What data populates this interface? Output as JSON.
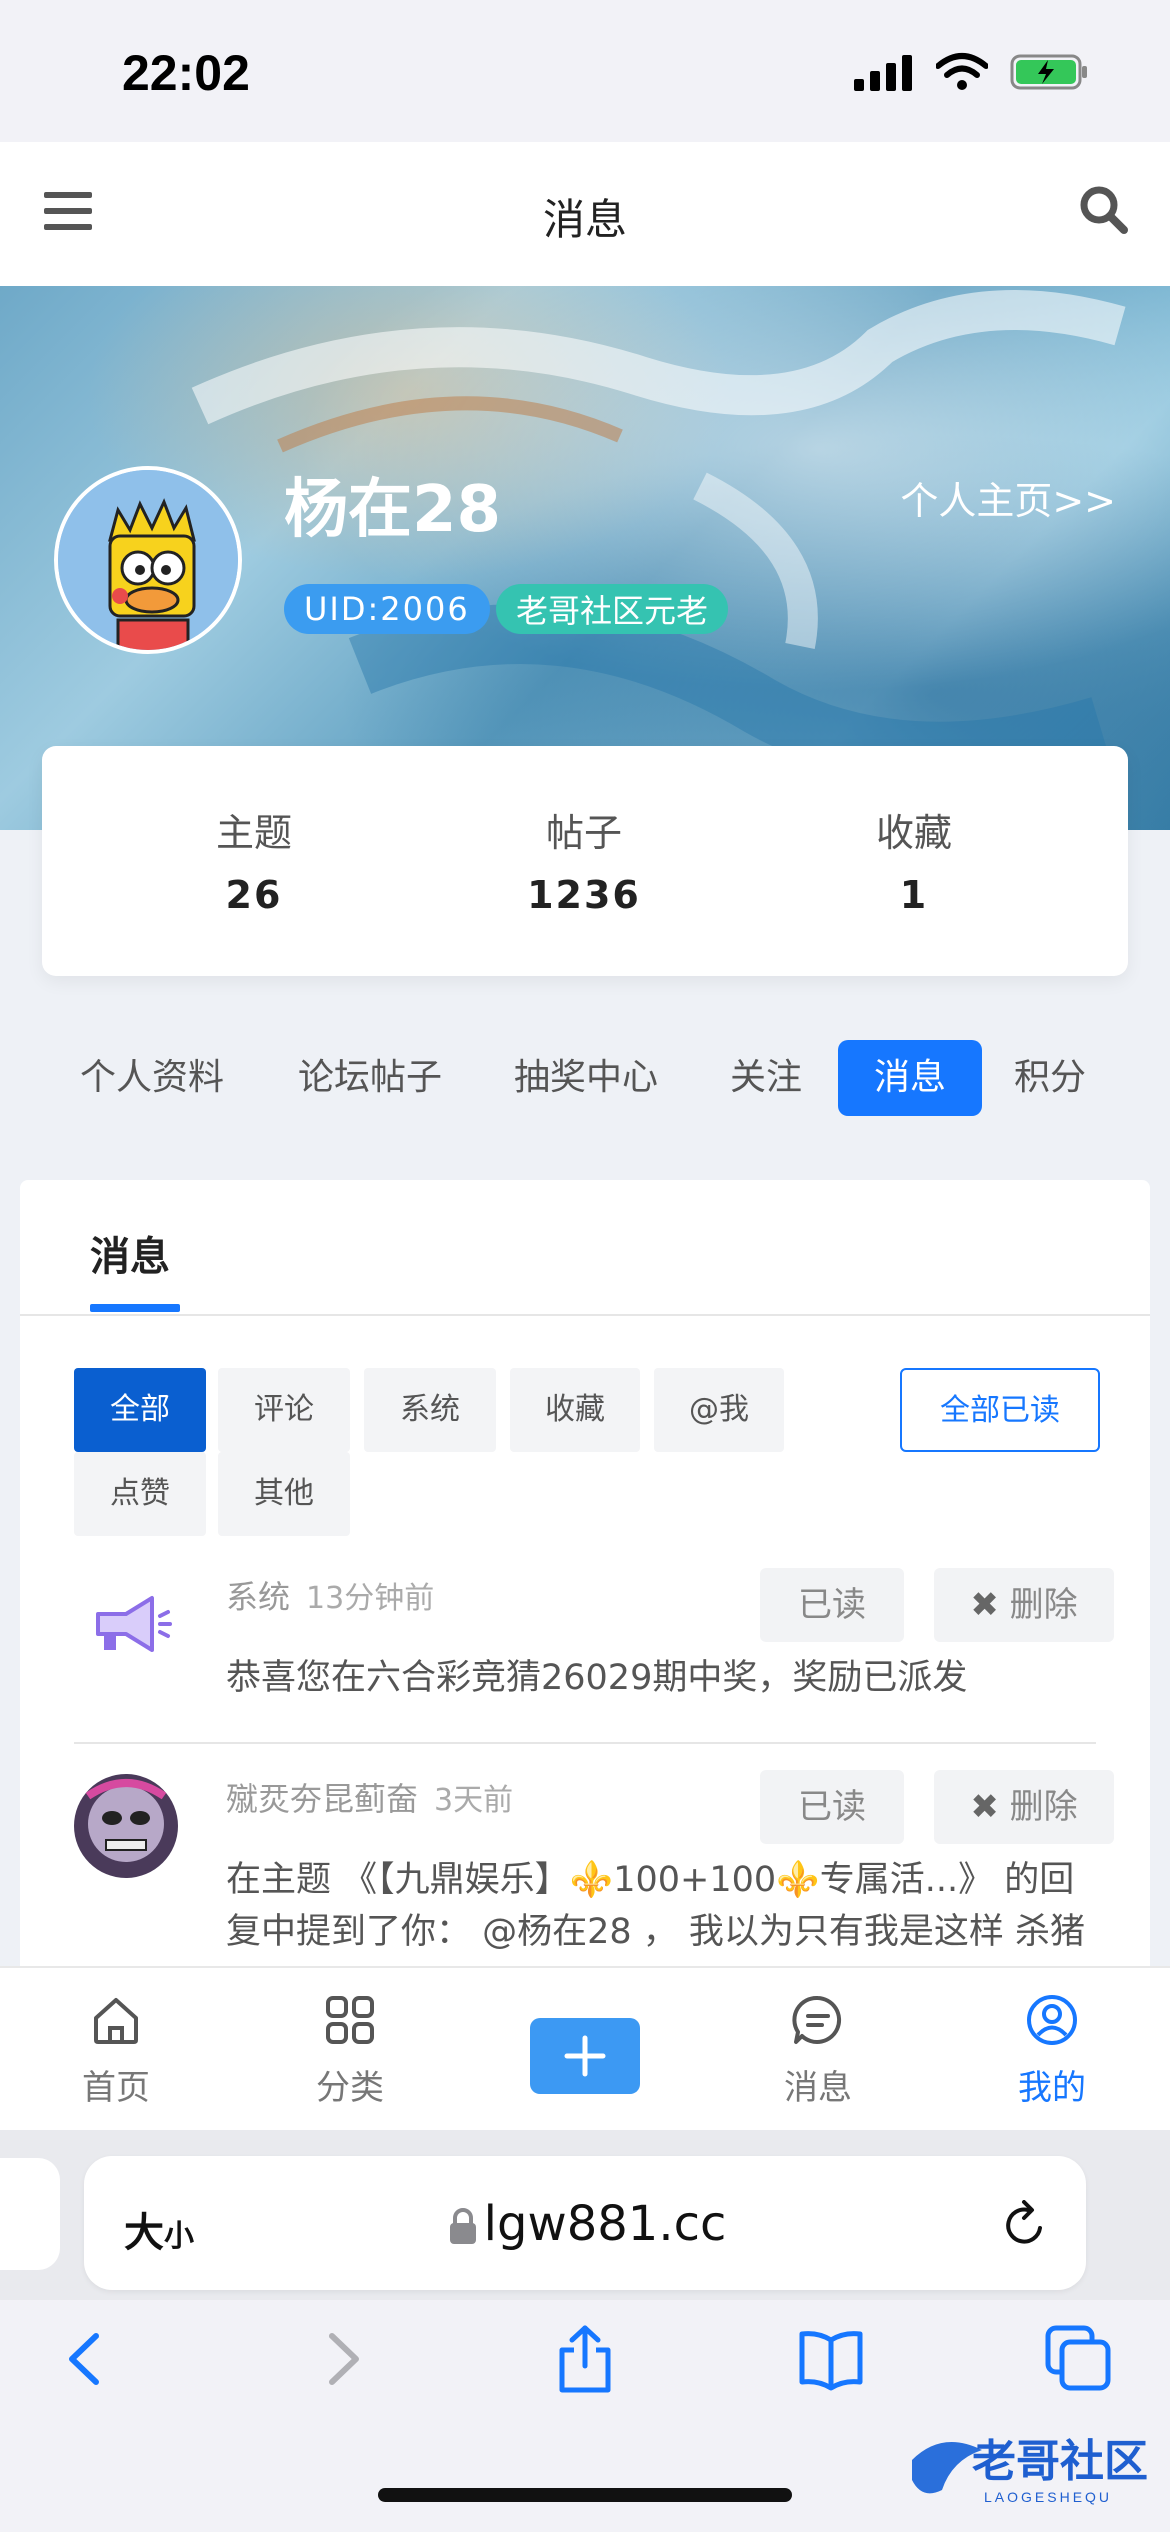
{
  "status": {
    "time": "22:02"
  },
  "header": {
    "title": "消息"
  },
  "profile": {
    "username": "杨在28",
    "home_link": "个人主页>>",
    "uid_badge": "UID:2006",
    "level_badge": "老哥社区元老"
  },
  "stats": [
    {
      "label": "主题",
      "value": "26"
    },
    {
      "label": "帖子",
      "value": "1236"
    },
    {
      "label": "收藏",
      "value": "1"
    }
  ],
  "nav_tabs": [
    "个人资料",
    "论坛帖子",
    "抽奖中心",
    "关注",
    "消息",
    "积分"
  ],
  "nav_active": "消息",
  "panel": {
    "title": "消息",
    "filters": [
      "全部",
      "评论",
      "系统",
      "收藏",
      "@我",
      "点赞",
      "其他"
    ],
    "active_filter": "全部",
    "mark_all_read": "全部已读"
  },
  "messages": [
    {
      "author": "系统",
      "time": "13分钟前",
      "read_label": "已读",
      "delete_label": "删除",
      "text": "恭喜您在六合彩竞猜26029期中奖，奖励已派发"
    },
    {
      "author": "殧烎夯昆蓟奤",
      "time": "3天前",
      "read_label": "已读",
      "delete_label": "删除",
      "text": "在主题 《【九鼎娱乐】⚜️100+100⚜️专属活...》 的回复中提到了你： @杨在28 ， 我以为只有我是这样 杀猪"
    }
  ],
  "tabbar": [
    {
      "label": "首页",
      "icon": "home-icon"
    },
    {
      "label": "分类",
      "icon": "grid-icon"
    },
    {
      "label": "消息",
      "icon": "chat-icon"
    },
    {
      "label": "我的",
      "icon": "user-icon"
    }
  ],
  "browser": {
    "text_size": "大",
    "text_size_small": "小",
    "url": "lgw881.cc"
  },
  "watermark": {
    "text": "老哥社区",
    "sub": "LAOGESHEQU"
  },
  "colors": {
    "accent": "#1677ff",
    "badge_uid": "#3b9cf0",
    "badge_level": "#35c3b1"
  }
}
